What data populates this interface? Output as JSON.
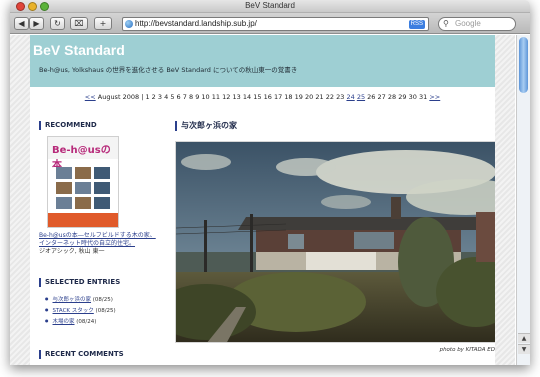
{
  "window": {
    "title": "BeV Standard"
  },
  "toolbar": {
    "back_label": "◀",
    "forward_label": "▶",
    "reload_label": "↻",
    "snapback_label": "⌧",
    "add_label": "+",
    "address": "http://bevstandard.landship.sub.jp/",
    "rss_label": "RSS",
    "search_placeholder": "Google"
  },
  "blog": {
    "title": "BeV Standard",
    "description": "Be-h@us, Yolkshaus の世界を進化させる BeV Standard についての秋山東一の覚書き"
  },
  "calendar": {
    "prev": "<<",
    "next": ">>",
    "month": "August 2008",
    "days": [
      "1",
      "2",
      "3",
      "4",
      "5",
      "6",
      "7",
      "8",
      "9",
      "10",
      "11",
      "12",
      "13",
      "14",
      "15",
      "16",
      "17",
      "18",
      "19",
      "20",
      "21",
      "22",
      "23",
      "24",
      "25",
      "26",
      "27",
      "28",
      "29",
      "30",
      "31"
    ],
    "linked_days": [
      "24",
      "25"
    ]
  },
  "sidebar": {
    "recommend_heading": "RECOMMEND",
    "book_logo": "Be-h@usの本",
    "book_caption": "Be-h@usの本―セルフビルドする木の家、インターネット時代の自立的住宅。",
    "book_author": "ジオアシック, 秋山 東一",
    "entries_heading": "SELECTED ENTRIES",
    "entries": [
      {
        "title": "与次郎ヶ浜の家",
        "date": "(08/25)"
      },
      {
        "title": "STACK スタック",
        "date": "(08/25)"
      },
      {
        "title": "木場の家",
        "date": "(08/24)"
      }
    ],
    "recent_heading": "RECENT COMMENTS"
  },
  "post": {
    "title": "与次郎ヶ浜の家",
    "photo_credit": "photo by KITADA ED"
  },
  "colors": {
    "banner": "#9ecfd3",
    "link": "#2b3f8c",
    "heading_bar": "#2b3f8c"
  }
}
